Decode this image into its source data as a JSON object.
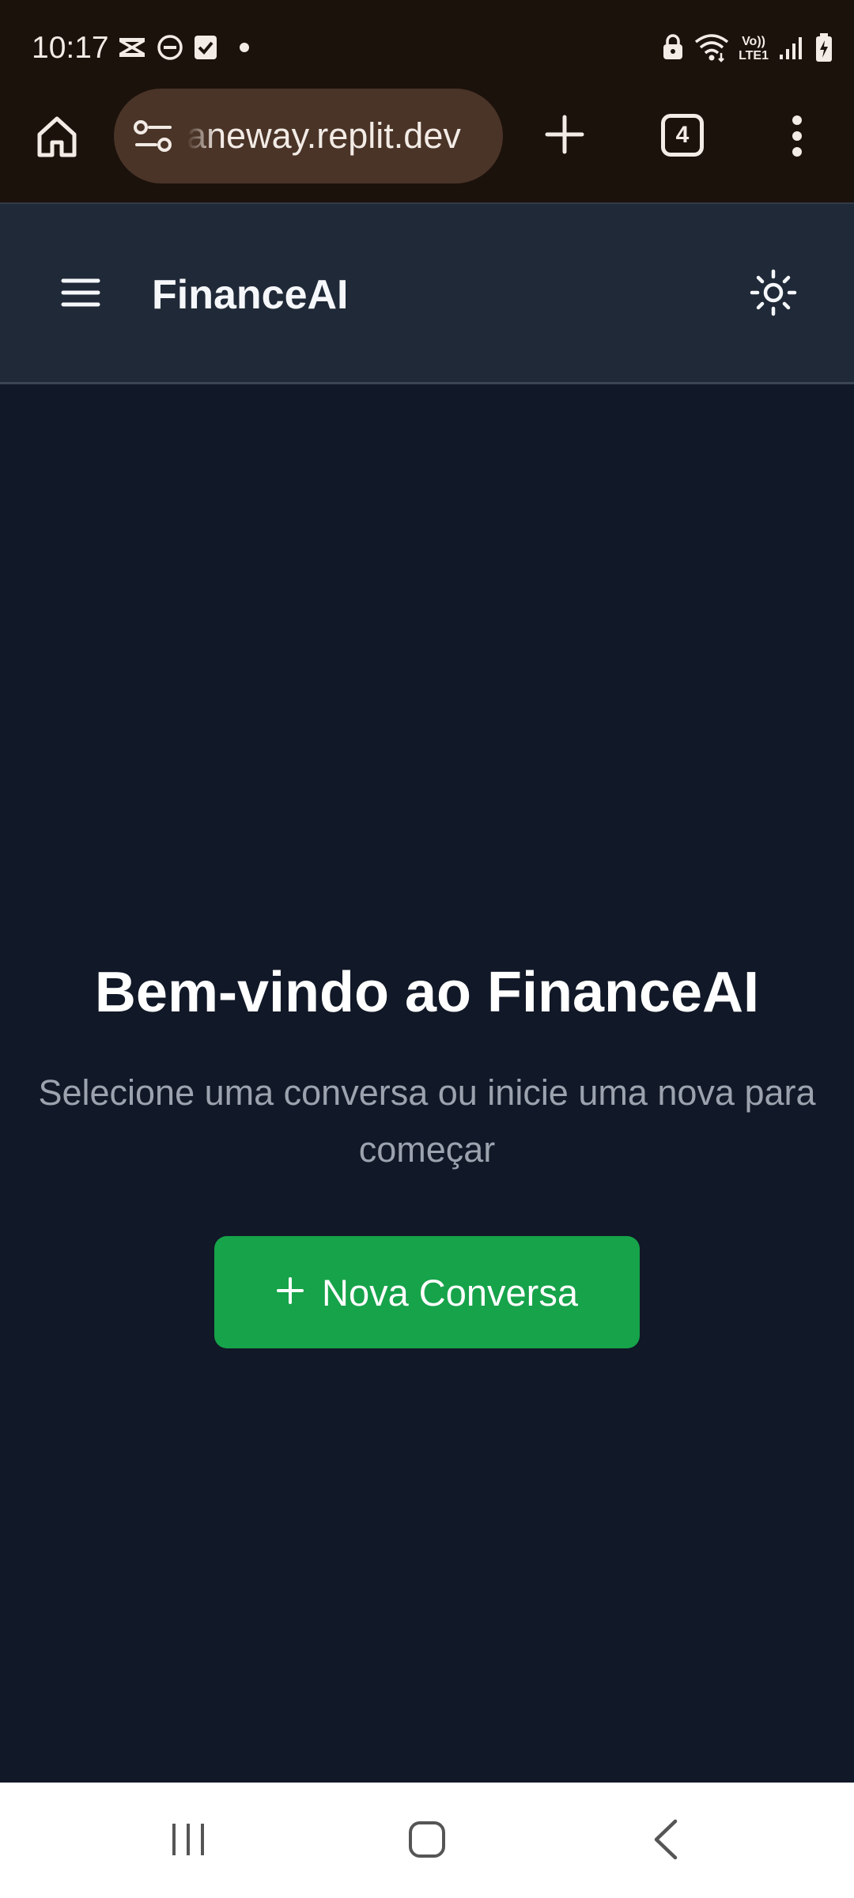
{
  "status_bar": {
    "time": "10:17",
    "left_icons": [
      "capcut-icon",
      "do-not-disturb-icon",
      "checkbox-icon",
      "dot-icon"
    ],
    "right_icons": [
      "lock-icon",
      "wifi-icon",
      "volte-lte-icon",
      "signal-icon",
      "battery-charging-icon"
    ],
    "volte_label": "Vo))",
    "lte_label": "LTE1"
  },
  "browser": {
    "url": "aneway.replit.dev",
    "tab_count": "4"
  },
  "app_header": {
    "title": "FinanceAI"
  },
  "welcome": {
    "title": "Bem-vindo ao FinanceAI",
    "subtitle": "Selecione uma conversa ou inicie uma nova para começar",
    "new_chat_label": "Nova Conversa"
  },
  "colors": {
    "chrome_bg": "#1c120c",
    "url_bar_bg": "#4a3427",
    "header_bg": "#1f2937",
    "page_bg": "#111827",
    "accent_green": "#16a34a",
    "subtitle_gray": "#9ca3af"
  }
}
